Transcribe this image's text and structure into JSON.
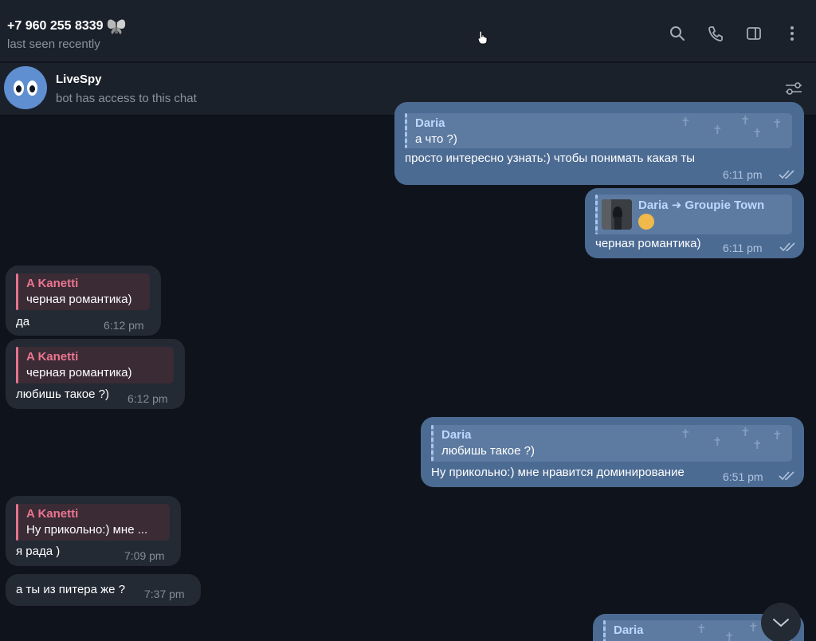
{
  "header": {
    "contact_name": "+7 960 255 8339",
    "status": "last seen recently",
    "icons": [
      "search-icon",
      "phone-icon",
      "sidebar-icon",
      "more-icon"
    ]
  },
  "bot_bar": {
    "name": "LiveSpy",
    "subtitle": "bot has access to this chat",
    "icon": "settings-sliders-icon"
  },
  "colors": {
    "background": "#0f131c",
    "outgoing_bubble": "#4c6b93",
    "incoming_bubble": "#232a34",
    "reply_name_outgoing": "#bcd8fb",
    "reply_name_incoming": "#eb7590"
  },
  "messages": [
    {
      "direction": "out",
      "reply_name": "Daria",
      "reply_text": "а что ?)",
      "text": "просто интересно узнать:) чтобы понимать какая ты",
      "time": "6:11 pm",
      "read": true
    },
    {
      "direction": "out",
      "forward_from": "Daria ➜ Groupie Town",
      "text": "черная романтика)",
      "time": "6:11 pm",
      "read": true
    },
    {
      "direction": "in",
      "reply_name": "A Kanetti",
      "reply_text": "черная романтика)",
      "text": "да",
      "time": "6:12 pm"
    },
    {
      "direction": "in",
      "reply_name": "A Kanetti",
      "reply_text": "черная романтика)",
      "text": "любишь такое ?)",
      "time": "6:12 pm"
    },
    {
      "direction": "out",
      "reply_name": "Daria",
      "reply_text": "любишь такое ?)",
      "text": "Ну прикольно:) мне нравится доминирование",
      "time": "6:51 pm",
      "read": true
    },
    {
      "direction": "in",
      "reply_name": "A Kanetti",
      "reply_text": "Ну прикольно:) мне ...",
      "text": "я рада )",
      "time": "7:09 pm"
    },
    {
      "direction": "in",
      "text": "а ты из питера же ?",
      "time": "7:37 pm"
    },
    {
      "direction": "out",
      "reply_name": "Daria"
    }
  ]
}
